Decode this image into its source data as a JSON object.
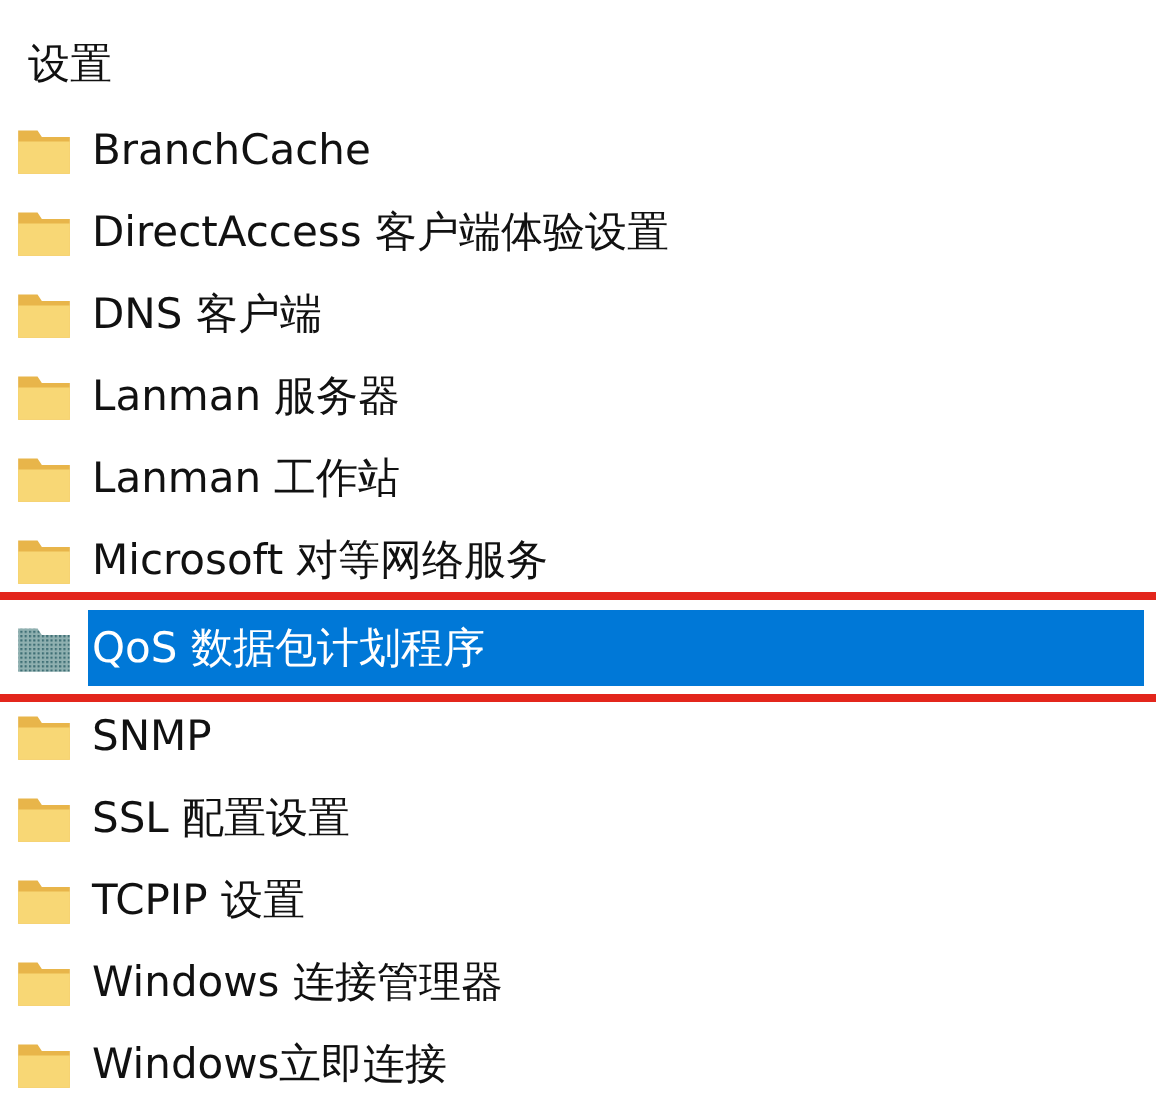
{
  "heading": "设置",
  "items": [
    {
      "label": "BranchCache",
      "selected": false,
      "kind": "folder",
      "annotated": false
    },
    {
      "label": "DirectAccess 客户端体验设置",
      "selected": false,
      "kind": "folder",
      "annotated": false
    },
    {
      "label": "DNS 客户端",
      "selected": false,
      "kind": "folder",
      "annotated": false
    },
    {
      "label": "Lanman 服务器",
      "selected": false,
      "kind": "folder",
      "annotated": false
    },
    {
      "label": "Lanman 工作站",
      "selected": false,
      "kind": "folder",
      "annotated": false
    },
    {
      "label": "Microsoft 对等网络服务",
      "selected": false,
      "kind": "folder",
      "annotated": false
    },
    {
      "label": "QoS 数据包计划程序",
      "selected": true,
      "kind": "policy",
      "annotated": true
    },
    {
      "label": "SNMP",
      "selected": false,
      "kind": "folder",
      "annotated": false
    },
    {
      "label": "SSL 配置设置",
      "selected": false,
      "kind": "folder",
      "annotated": false
    },
    {
      "label": "TCPIP 设置",
      "selected": false,
      "kind": "folder",
      "annotated": false
    },
    {
      "label": "Windows 连接管理器",
      "selected": false,
      "kind": "folder",
      "annotated": false
    },
    {
      "label": "Windows立即连接",
      "selected": false,
      "kind": "folder",
      "annotated": false
    }
  ]
}
